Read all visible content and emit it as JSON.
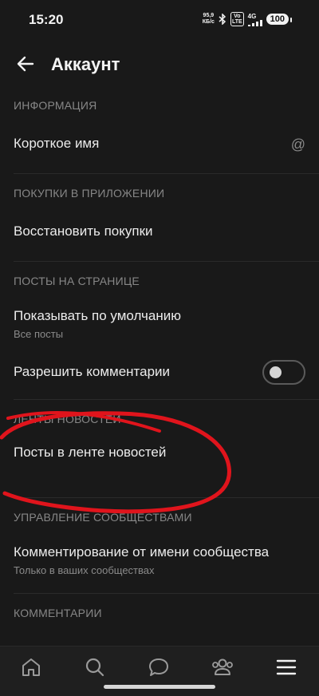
{
  "status_bar": {
    "time": "15:20",
    "net_speed_value": "95,9",
    "net_speed_unit": "КБ/с",
    "volte_top": "Vo",
    "volte_bottom": "LTE",
    "net_type": "4G",
    "battery": "100"
  },
  "header": {
    "title": "Аккаунт"
  },
  "sections": {
    "info": {
      "title": "ИНФОРМАЦИЯ",
      "short_name_label": "Короткое имя",
      "short_name_value": "@"
    },
    "purchases": {
      "title": "ПОКУПКИ В ПРИЛОЖЕНИИ",
      "restore_label": "Восстановить покупки"
    },
    "wall_posts": {
      "title": "ПОСТЫ НА СТРАНИЦЕ",
      "default_label": "Показывать по умолчанию",
      "default_value": "Все посты",
      "allow_comments_label": "Разрешить комментарии",
      "allow_comments_on": false
    },
    "news_feeds": {
      "title": "ЛЕНТЫ НОВОСТЕЙ",
      "feed_posts_label": "Посты в ленте новостей"
    },
    "communities": {
      "title": "УПРАВЛЕНИЕ СООБЩЕСТВАМИ",
      "comment_as_label": "Комментирование от имени сообщества",
      "comment_as_value": "Только в ваших сообществах"
    },
    "comments": {
      "title": "КОММЕНТАРИИ"
    }
  },
  "bottom_nav": {
    "items": [
      "home-icon",
      "search-icon",
      "messages-icon",
      "friends-icon",
      "menu-icon"
    ]
  },
  "colors": {
    "background": "#191919",
    "annotation": "#e0141c"
  }
}
